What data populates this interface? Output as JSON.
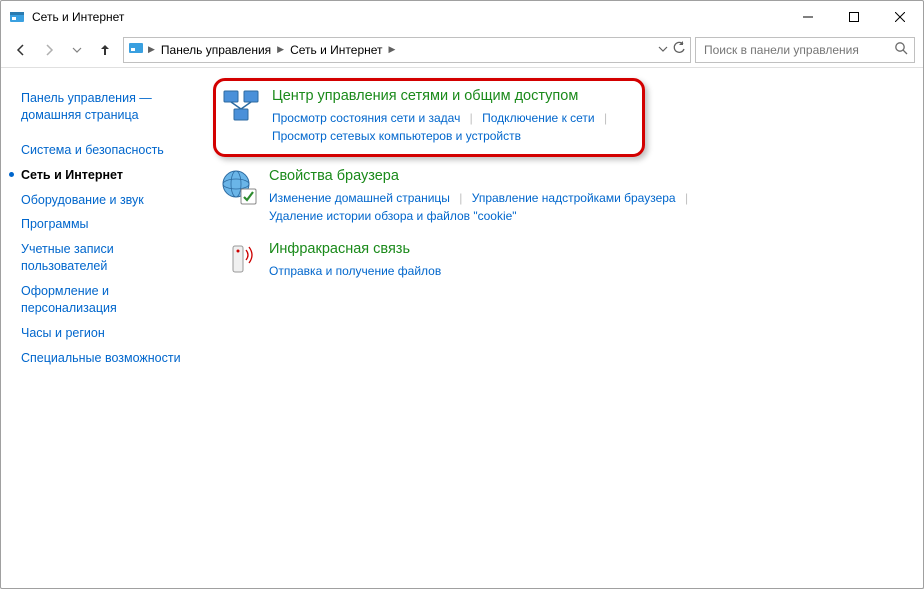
{
  "window": {
    "title": "Сеть и Интернет"
  },
  "breadcrumb": {
    "root": "Панель управления",
    "current": "Сеть и Интернет"
  },
  "search": {
    "placeholder": "Поиск в панели управления"
  },
  "sidebar": {
    "home1": "Панель управления —",
    "home2": "домашняя страница",
    "items": [
      "Система и безопасность",
      "Сеть и Интернет",
      "Оборудование и звук",
      "Программы",
      "Учетные записи пользователей",
      "Оформление и персонализация",
      "Часы и регион",
      "Специальные возможности"
    ]
  },
  "categories": [
    {
      "title": "Центр управления сетями и общим доступом",
      "links": [
        "Просмотр состояния сети и задач",
        "Подключение к сети",
        "Просмотр сетевых компьютеров и устройств"
      ]
    },
    {
      "title": "Свойства браузера",
      "links": [
        "Изменение домашней страницы",
        "Управление надстройками браузера",
        "Удаление истории обзора и файлов \"cookie\""
      ]
    },
    {
      "title": "Инфракрасная связь",
      "links": [
        "Отправка и получение файлов"
      ]
    }
  ]
}
